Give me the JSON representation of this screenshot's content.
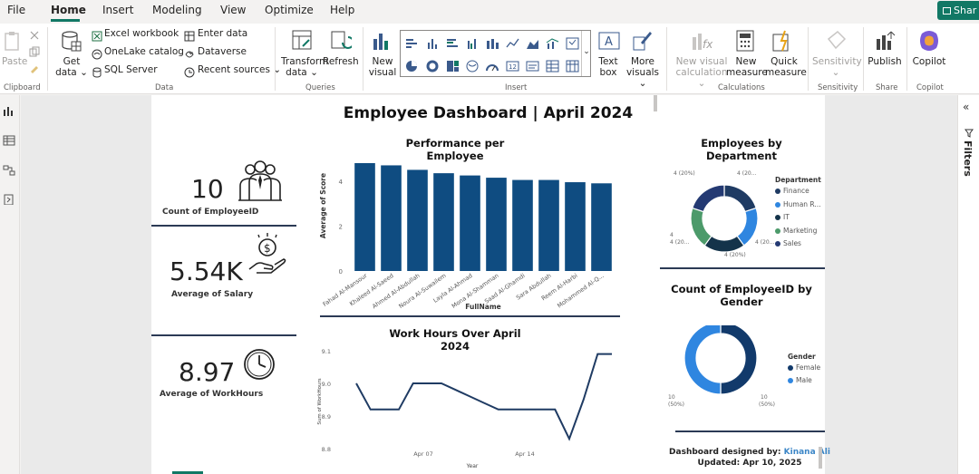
{
  "menu": {
    "items": [
      "File",
      "Home",
      "Insert",
      "Modeling",
      "View",
      "Optimize",
      "Help"
    ],
    "active": "Home",
    "share_label": "Shar"
  },
  "ribbon": {
    "clipboard": {
      "paste": "Paste",
      "group": "Clipboard"
    },
    "data": {
      "get_data": "Get data",
      "get_data_l1": "Get",
      "get_data_l2": "data",
      "excel": "Excel workbook",
      "onelake": "OneLake catalog",
      "sql": "SQL Server",
      "enter_data": "Enter data",
      "dataverse": "Dataverse",
      "recent": "Recent sources",
      "group": "Data"
    },
    "queries": {
      "transform_l1": "Transform",
      "transform_l2": "data",
      "refresh": "Refresh",
      "group": "Queries"
    },
    "insert": {
      "new_visual_l1": "New",
      "new_visual_l2": "visual",
      "text_box_l1": "Text",
      "text_box_l2": "box",
      "more_visuals_l1": "More",
      "more_visuals_l2": "visuals",
      "group": "Insert"
    },
    "calculations": {
      "new_visual_calc_l1": "New visual",
      "new_visual_calc_l2": "calculation",
      "new_measure_l1": "New",
      "new_measure_l2": "measure",
      "quick_measure_l1": "Quick",
      "quick_measure_l2": "measure",
      "group": "Calculations"
    },
    "sensitivity": {
      "label": "Sensitivity",
      "group": "Sensitivity"
    },
    "share": {
      "publish": "Publish",
      "group": "Share"
    },
    "copilot": {
      "label": "Copilot",
      "group": "Copilot"
    }
  },
  "filters": {
    "label": "Filters"
  },
  "report": {
    "title": "Employee Dashboard | April 2024",
    "kpis": [
      {
        "value": "10",
        "label": "Count of EmployeeID",
        "icon": "team-icon"
      },
      {
        "value": "5.54K",
        "label": "Average of Salary",
        "icon": "salary-hand-icon"
      },
      {
        "value": "8.97",
        "label": "Average of WorkHours",
        "icon": "clock-icon"
      }
    ],
    "footer": {
      "designed_by": "Dashboard designed by:",
      "designer": "Kinana Ali",
      "updated": "Updated: Apr 10, 2025"
    }
  },
  "colors": {
    "bar": "#0f4c81",
    "line": "#1f3b63",
    "dept": {
      "Finance": "#1f3b63",
      "Human R...": "#2f86e0",
      "IT": "#14334a",
      "Marketing": "#4c9a6a",
      "Sales": "#243a73"
    },
    "gender": {
      "Female": "#123a6b",
      "Male": "#2f86e0"
    }
  },
  "chart_data": [
    {
      "type": "bar",
      "title": "Performance per Employee",
      "xlabel": "FullName",
      "ylabel": "Average of Score",
      "ylim": [
        0,
        5
      ],
      "yticks": [
        "0",
        "2",
        "4"
      ],
      "categories": [
        "Fahad Al-Mansour",
        "Khaleed Al-Saeed",
        "Ahmed Al-Abdullah",
        "Noura Al-Suwailem",
        "Layla Al-Ahmad",
        "Mona Al-Shamman",
        "Saad Al-Ghamdi",
        "Sara Abdullah",
        "Reem Al-Harbi",
        "Mohammed Al-Q..."
      ],
      "values": [
        4.8,
        4.7,
        4.5,
        4.35,
        4.25,
        4.15,
        4.05,
        4.05,
        3.95,
        3.9
      ]
    },
    {
      "type": "line",
      "title": "Work Hours Over April 2024",
      "xlabel": "Year",
      "ylabel": "Sum of WorkHours",
      "ylim": [
        8.8,
        9.1
      ],
      "yticks": [
        "8.8",
        "8.9",
        "9.0",
        "9.1"
      ],
      "xticks": [
        "Apr 07",
        "Apr 14"
      ],
      "x": [
        "2024-04-01",
        "2024-04-02",
        "2024-04-03",
        "2024-04-04",
        "2024-04-05",
        "2024-04-06",
        "2024-04-07",
        "2024-04-08",
        "2024-04-09",
        "2024-04-10",
        "2024-04-11",
        "2024-04-12",
        "2024-04-13",
        "2024-04-14",
        "2024-04-15",
        "2024-04-16",
        "2024-04-17",
        "2024-04-18"
      ],
      "values": [
        9.0,
        8.92,
        8.92,
        8.92,
        9.0,
        9.0,
        9.0,
        8.98,
        8.96,
        8.94,
        8.92,
        8.92,
        8.92,
        8.92,
        8.92,
        8.83,
        8.95,
        9.09,
        9.09
      ]
    },
    {
      "type": "pie",
      "title": "Employees by Department",
      "legend_title": "Department",
      "categories": [
        "Finance",
        "Human R...",
        "IT",
        "Marketing",
        "Sales"
      ],
      "values": [
        2,
        2,
        2,
        2,
        2
      ],
      "data_labels": [
        "4 (20%)",
        "4 (20...",
        "4 (20%)",
        "4 (20...",
        "4 (20%)"
      ]
    },
    {
      "type": "pie",
      "title": "Count of EmployeeID by Gender",
      "legend_title": "Gender",
      "categories": [
        "Female",
        "Male"
      ],
      "values": [
        5,
        5
      ],
      "data_labels": [
        "10 (50%)",
        "10 (50%)"
      ]
    }
  ]
}
